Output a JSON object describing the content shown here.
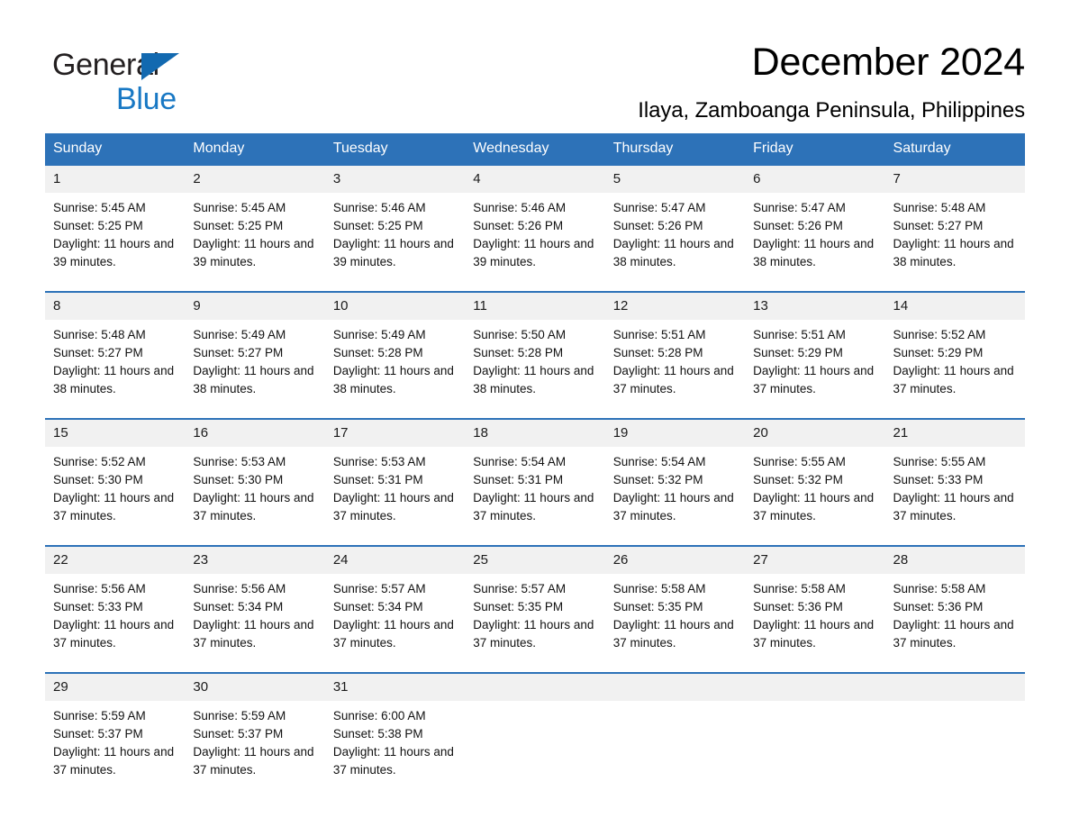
{
  "brand": {
    "name_part1": "General",
    "name_part2": "Blue",
    "triangle_color": "#1269b0",
    "blue_color": "#1878c4"
  },
  "header": {
    "title": "December 2024",
    "subtitle": "Ilaya, Zamboanga Peninsula, Philippines"
  },
  "theme": {
    "header_blue": "#2d72b8",
    "date_band_gray": "#f1f1f1",
    "cell_white": "#ffffff"
  },
  "calendar": {
    "day_headers": [
      "Sunday",
      "Monday",
      "Tuesday",
      "Wednesday",
      "Thursday",
      "Friday",
      "Saturday"
    ],
    "weeks": [
      [
        {
          "date": "1",
          "sunrise": "Sunrise: 5:45 AM",
          "sunset": "Sunset: 5:25 PM",
          "daylight": "Daylight: 11 hours and 39 minutes."
        },
        {
          "date": "2",
          "sunrise": "Sunrise: 5:45 AM",
          "sunset": "Sunset: 5:25 PM",
          "daylight": "Daylight: 11 hours and 39 minutes."
        },
        {
          "date": "3",
          "sunrise": "Sunrise: 5:46 AM",
          "sunset": "Sunset: 5:25 PM",
          "daylight": "Daylight: 11 hours and 39 minutes."
        },
        {
          "date": "4",
          "sunrise": "Sunrise: 5:46 AM",
          "sunset": "Sunset: 5:26 PM",
          "daylight": "Daylight: 11 hours and 39 minutes."
        },
        {
          "date": "5",
          "sunrise": "Sunrise: 5:47 AM",
          "sunset": "Sunset: 5:26 PM",
          "daylight": "Daylight: 11 hours and 38 minutes."
        },
        {
          "date": "6",
          "sunrise": "Sunrise: 5:47 AM",
          "sunset": "Sunset: 5:26 PM",
          "daylight": "Daylight: 11 hours and 38 minutes."
        },
        {
          "date": "7",
          "sunrise": "Sunrise: 5:48 AM",
          "sunset": "Sunset: 5:27 PM",
          "daylight": "Daylight: 11 hours and 38 minutes."
        }
      ],
      [
        {
          "date": "8",
          "sunrise": "Sunrise: 5:48 AM",
          "sunset": "Sunset: 5:27 PM",
          "daylight": "Daylight: 11 hours and 38 minutes."
        },
        {
          "date": "9",
          "sunrise": "Sunrise: 5:49 AM",
          "sunset": "Sunset: 5:27 PM",
          "daylight": "Daylight: 11 hours and 38 minutes."
        },
        {
          "date": "10",
          "sunrise": "Sunrise: 5:49 AM",
          "sunset": "Sunset: 5:28 PM",
          "daylight": "Daylight: 11 hours and 38 minutes."
        },
        {
          "date": "11",
          "sunrise": "Sunrise: 5:50 AM",
          "sunset": "Sunset: 5:28 PM",
          "daylight": "Daylight: 11 hours and 38 minutes."
        },
        {
          "date": "12",
          "sunrise": "Sunrise: 5:51 AM",
          "sunset": "Sunset: 5:28 PM",
          "daylight": "Daylight: 11 hours and 37 minutes."
        },
        {
          "date": "13",
          "sunrise": "Sunrise: 5:51 AM",
          "sunset": "Sunset: 5:29 PM",
          "daylight": "Daylight: 11 hours and 37 minutes."
        },
        {
          "date": "14",
          "sunrise": "Sunrise: 5:52 AM",
          "sunset": "Sunset: 5:29 PM",
          "daylight": "Daylight: 11 hours and 37 minutes."
        }
      ],
      [
        {
          "date": "15",
          "sunrise": "Sunrise: 5:52 AM",
          "sunset": "Sunset: 5:30 PM",
          "daylight": "Daylight: 11 hours and 37 minutes."
        },
        {
          "date": "16",
          "sunrise": "Sunrise: 5:53 AM",
          "sunset": "Sunset: 5:30 PM",
          "daylight": "Daylight: 11 hours and 37 minutes."
        },
        {
          "date": "17",
          "sunrise": "Sunrise: 5:53 AM",
          "sunset": "Sunset: 5:31 PM",
          "daylight": "Daylight: 11 hours and 37 minutes."
        },
        {
          "date": "18",
          "sunrise": "Sunrise: 5:54 AM",
          "sunset": "Sunset: 5:31 PM",
          "daylight": "Daylight: 11 hours and 37 minutes."
        },
        {
          "date": "19",
          "sunrise": "Sunrise: 5:54 AM",
          "sunset": "Sunset: 5:32 PM",
          "daylight": "Daylight: 11 hours and 37 minutes."
        },
        {
          "date": "20",
          "sunrise": "Sunrise: 5:55 AM",
          "sunset": "Sunset: 5:32 PM",
          "daylight": "Daylight: 11 hours and 37 minutes."
        },
        {
          "date": "21",
          "sunrise": "Sunrise: 5:55 AM",
          "sunset": "Sunset: 5:33 PM",
          "daylight": "Daylight: 11 hours and 37 minutes."
        }
      ],
      [
        {
          "date": "22",
          "sunrise": "Sunrise: 5:56 AM",
          "sunset": "Sunset: 5:33 PM",
          "daylight": "Daylight: 11 hours and 37 minutes."
        },
        {
          "date": "23",
          "sunrise": "Sunrise: 5:56 AM",
          "sunset": "Sunset: 5:34 PM",
          "daylight": "Daylight: 11 hours and 37 minutes."
        },
        {
          "date": "24",
          "sunrise": "Sunrise: 5:57 AM",
          "sunset": "Sunset: 5:34 PM",
          "daylight": "Daylight: 11 hours and 37 minutes."
        },
        {
          "date": "25",
          "sunrise": "Sunrise: 5:57 AM",
          "sunset": "Sunset: 5:35 PM",
          "daylight": "Daylight: 11 hours and 37 minutes."
        },
        {
          "date": "26",
          "sunrise": "Sunrise: 5:58 AM",
          "sunset": "Sunset: 5:35 PM",
          "daylight": "Daylight: 11 hours and 37 minutes."
        },
        {
          "date": "27",
          "sunrise": "Sunrise: 5:58 AM",
          "sunset": "Sunset: 5:36 PM",
          "daylight": "Daylight: 11 hours and 37 minutes."
        },
        {
          "date": "28",
          "sunrise": "Sunrise: 5:58 AM",
          "sunset": "Sunset: 5:36 PM",
          "daylight": "Daylight: 11 hours and 37 minutes."
        }
      ],
      [
        {
          "date": "29",
          "sunrise": "Sunrise: 5:59 AM",
          "sunset": "Sunset: 5:37 PM",
          "daylight": "Daylight: 11 hours and 37 minutes."
        },
        {
          "date": "30",
          "sunrise": "Sunrise: 5:59 AM",
          "sunset": "Sunset: 5:37 PM",
          "daylight": "Daylight: 11 hours and 37 minutes."
        },
        {
          "date": "31",
          "sunrise": "Sunrise: 6:00 AM",
          "sunset": "Sunset: 5:38 PM",
          "daylight": "Daylight: 11 hours and 37 minutes."
        },
        {
          "date": "",
          "sunrise": "",
          "sunset": "",
          "daylight": ""
        },
        {
          "date": "",
          "sunrise": "",
          "sunset": "",
          "daylight": ""
        },
        {
          "date": "",
          "sunrise": "",
          "sunset": "",
          "daylight": ""
        },
        {
          "date": "",
          "sunrise": "",
          "sunset": "",
          "daylight": ""
        }
      ]
    ]
  }
}
